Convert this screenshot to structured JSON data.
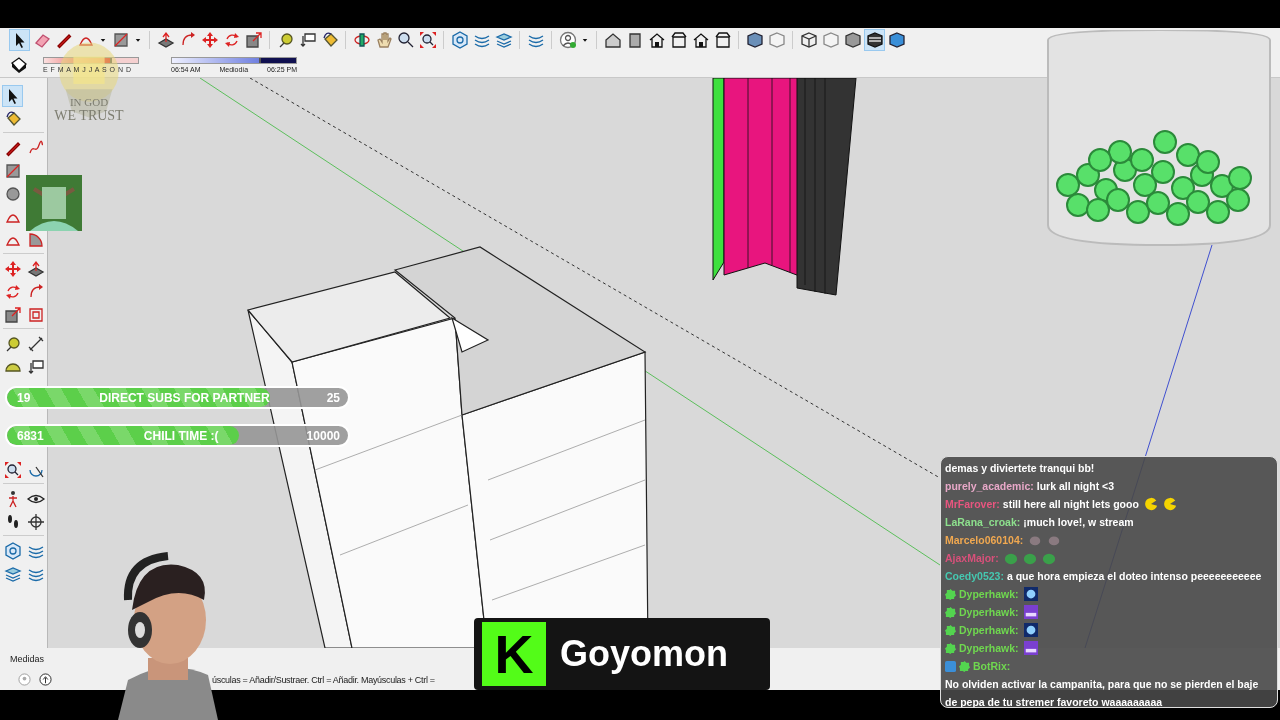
{
  "top_toolbar": [
    [
      {
        "kind": "select",
        "selected": true
      },
      {
        "kind": "eraser",
        "selected": false
      },
      {
        "kind": "pencil",
        "selected": false
      },
      {
        "kind": "arc",
        "selected": false
      },
      {
        "kind": "caret",
        "selected": false
      },
      {
        "kind": "rect",
        "selected": false
      },
      {
        "kind": "caret",
        "selected": false
      }
    ],
    [
      {
        "kind": "pushpull",
        "selected": false
      },
      {
        "kind": "followme",
        "selected": false
      },
      {
        "kind": "move",
        "selected": false
      },
      {
        "kind": "rotate",
        "selected": false
      },
      {
        "kind": "scale",
        "selected": false
      }
    ],
    [
      {
        "kind": "tape",
        "selected": false
      },
      {
        "kind": "label",
        "selected": false
      },
      {
        "kind": "paint",
        "selected": false
      }
    ],
    [
      {
        "kind": "orbit",
        "selected": false
      },
      {
        "kind": "pan",
        "selected": false
      },
      {
        "kind": "zoom",
        "selected": false
      },
      {
        "kind": "extents",
        "selected": false
      }
    ],
    [
      {
        "kind": "hexagon",
        "selected": false
      },
      {
        "kind": "stack",
        "selected": false
      },
      {
        "kind": "layers",
        "selected": false
      }
    ],
    [
      {
        "kind": "stack",
        "selected": false
      }
    ],
    [
      {
        "kind": "user",
        "selected": false
      },
      {
        "kind": "caret",
        "selected": false
      }
    ],
    [
      {
        "kind": "house3d",
        "selected": false
      },
      {
        "kind": "box",
        "selected": false
      },
      {
        "kind": "house",
        "selected": false
      },
      {
        "kind": "house2",
        "selected": false
      },
      {
        "kind": "house",
        "selected": false
      },
      {
        "kind": "house2",
        "selected": false
      }
    ],
    [
      {
        "kind": "cube",
        "selected": false
      },
      {
        "kind": "cubewhite",
        "selected": false
      }
    ],
    [
      {
        "kind": "cubewire",
        "selected": false
      },
      {
        "kind": "cubewhite",
        "selected": false
      },
      {
        "kind": "cubegrey",
        "selected": false
      },
      {
        "kind": "cubestripe",
        "selected": true
      },
      {
        "kind": "cubeblue",
        "selected": false
      }
    ]
  ],
  "shadow_bar": {
    "style_tool": {
      "kind": "stylebox",
      "selected": false
    },
    "months": "E F M A M J J A S O N D",
    "date_slider": {
      "level": 0.72
    },
    "time_slider": {
      "level": 0.72
    },
    "sunrise": "06:54 AM",
    "noon": "Mediodía",
    "sunset": "06:25 PM"
  },
  "logo": {
    "line_1": "IN GOD",
    "line_2": "WE TRUST"
  },
  "left_toolbar_upper": [
    [
      [
        {
          "kind": "select",
          "selected": true
        }
      ],
      [
        {
          "kind": "paint",
          "selected": false
        }
      ]
    ],
    [
      [
        {
          "kind": "pencil",
          "selected": false
        },
        {
          "kind": "freehand",
          "selected": false
        }
      ],
      [
        {
          "kind": "rect",
          "selected": false
        }
      ],
      [
        {
          "kind": "circle",
          "selected": false
        }
      ],
      [
        {
          "kind": "arc",
          "selected": false
        }
      ],
      [
        {
          "kind": "arc",
          "selected": false
        },
        {
          "kind": "pie",
          "selected": false
        }
      ]
    ],
    [
      [
        {
          "kind": "move",
          "selected": false
        },
        {
          "kind": "pushpull",
          "selected": false
        }
      ],
      [
        {
          "kind": "rotate",
          "selected": false
        },
        {
          "kind": "followme",
          "selected": false
        }
      ],
      [
        {
          "kind": "scale",
          "selected": false
        },
        {
          "kind": "offset",
          "selected": false
        }
      ]
    ],
    [
      [
        {
          "kind": "tape",
          "selected": false
        },
        {
          "kind": "dimension",
          "selected": false
        }
      ],
      [
        {
          "kind": "protractor",
          "selected": false
        },
        {
          "kind": "label",
          "selected": false
        }
      ]
    ]
  ],
  "left_toolbar_lower": [
    [
      [
        {
          "kind": "extents",
          "selected": false
        },
        {
          "kind": "previous",
          "selected": false
        }
      ]
    ],
    [
      [
        {
          "kind": "walk",
          "selected": false
        },
        {
          "kind": "eye",
          "selected": false
        }
      ],
      [
        {
          "kind": "foot",
          "selected": false
        },
        {
          "kind": "crosshair",
          "selected": false
        }
      ]
    ],
    [
      [
        {
          "kind": "hexagon",
          "selected": false
        },
        {
          "kind": "stack",
          "selected": false
        }
      ],
      [
        {
          "kind": "layers",
          "selected": false
        },
        {
          "kind": "stack",
          "selected": false
        }
      ]
    ]
  ],
  "goals": [
    {
      "current": "19",
      "label": "DIRECT SUBS FOR PARTNER",
      "target": "25",
      "level": 0.77
    },
    {
      "current": "6831",
      "label": "CHILI TIME :(",
      "target": "10000",
      "level": 0.68
    }
  ],
  "status_bar": {
    "measurements_label": "Medidas",
    "hint": "úsculas = Añadir/Sustraer. Ctrl = Añadir. Mayúsculas + Ctrl ="
  },
  "streamer": {
    "logo_letter": "K",
    "name": "Goyomon"
  },
  "chat": {
    "messages": [
      {
        "text": "demas y diviertete tranqui bb!"
      },
      {
        "user": "purely_academic:",
        "color": "#e8a8c8",
        "text": "lurk all night <3"
      },
      {
        "user": "MrFarover:",
        "color": "#e8557f",
        "text": "still here all night lets gooo",
        "emotes": [
          {
            "kind": "pacman"
          },
          {
            "kind": "pacman"
          }
        ]
      },
      {
        "user": "LaRana_croak:",
        "color": "#8de08d",
        "text": "¡much love!, w stream"
      },
      {
        "user": "Marcelo060104:",
        "color": "#f0a850",
        "emotes": [
          {
            "kind": "rat"
          },
          {
            "kind": "rat"
          }
        ]
      },
      {
        "user": "AjaxMajor:",
        "color": "#d8507a",
        "emotes": [
          {
            "kind": "frog"
          },
          {
            "kind": "frog"
          },
          {
            "kind": "frog"
          }
        ]
      },
      {
        "user": "Coedy0523:",
        "color": "#45c8b0",
        "text": "a que hora empieza el doteo intenso peeeeeeeeeee"
      },
      {
        "user": "Dyperhawk:",
        "color": "#6fd84f",
        "badges": [
          {
            "kind": "verified"
          }
        ],
        "emotes": [
          {
            "kind": "gem"
          }
        ]
      },
      {
        "user": "Dyperhawk:",
        "color": "#6fd84f",
        "badges": [
          {
            "kind": "verified"
          }
        ],
        "emotes": [
          {
            "kind": "hype"
          }
        ]
      },
      {
        "user": "Dyperhawk:",
        "color": "#6fd84f",
        "badges": [
          {
            "kind": "verified"
          }
        ],
        "emotes": [
          {
            "kind": "gem"
          }
        ]
      },
      {
        "user": "Dyperhawk:",
        "color": "#6fd84f",
        "badges": [
          {
            "kind": "verified"
          }
        ],
        "emotes": [
          {
            "kind": "hype"
          }
        ]
      },
      {
        "user": "BotRix:",
        "color": "#6fd84f",
        "badges": [
          {
            "kind": "bot"
          },
          {
            "kind": "verified"
          }
        ],
        "text": "No olviden activar la campanita, para que no se pierden el baje de pepa de tu stremer favoreto waaaaaaaaa"
      }
    ]
  }
}
